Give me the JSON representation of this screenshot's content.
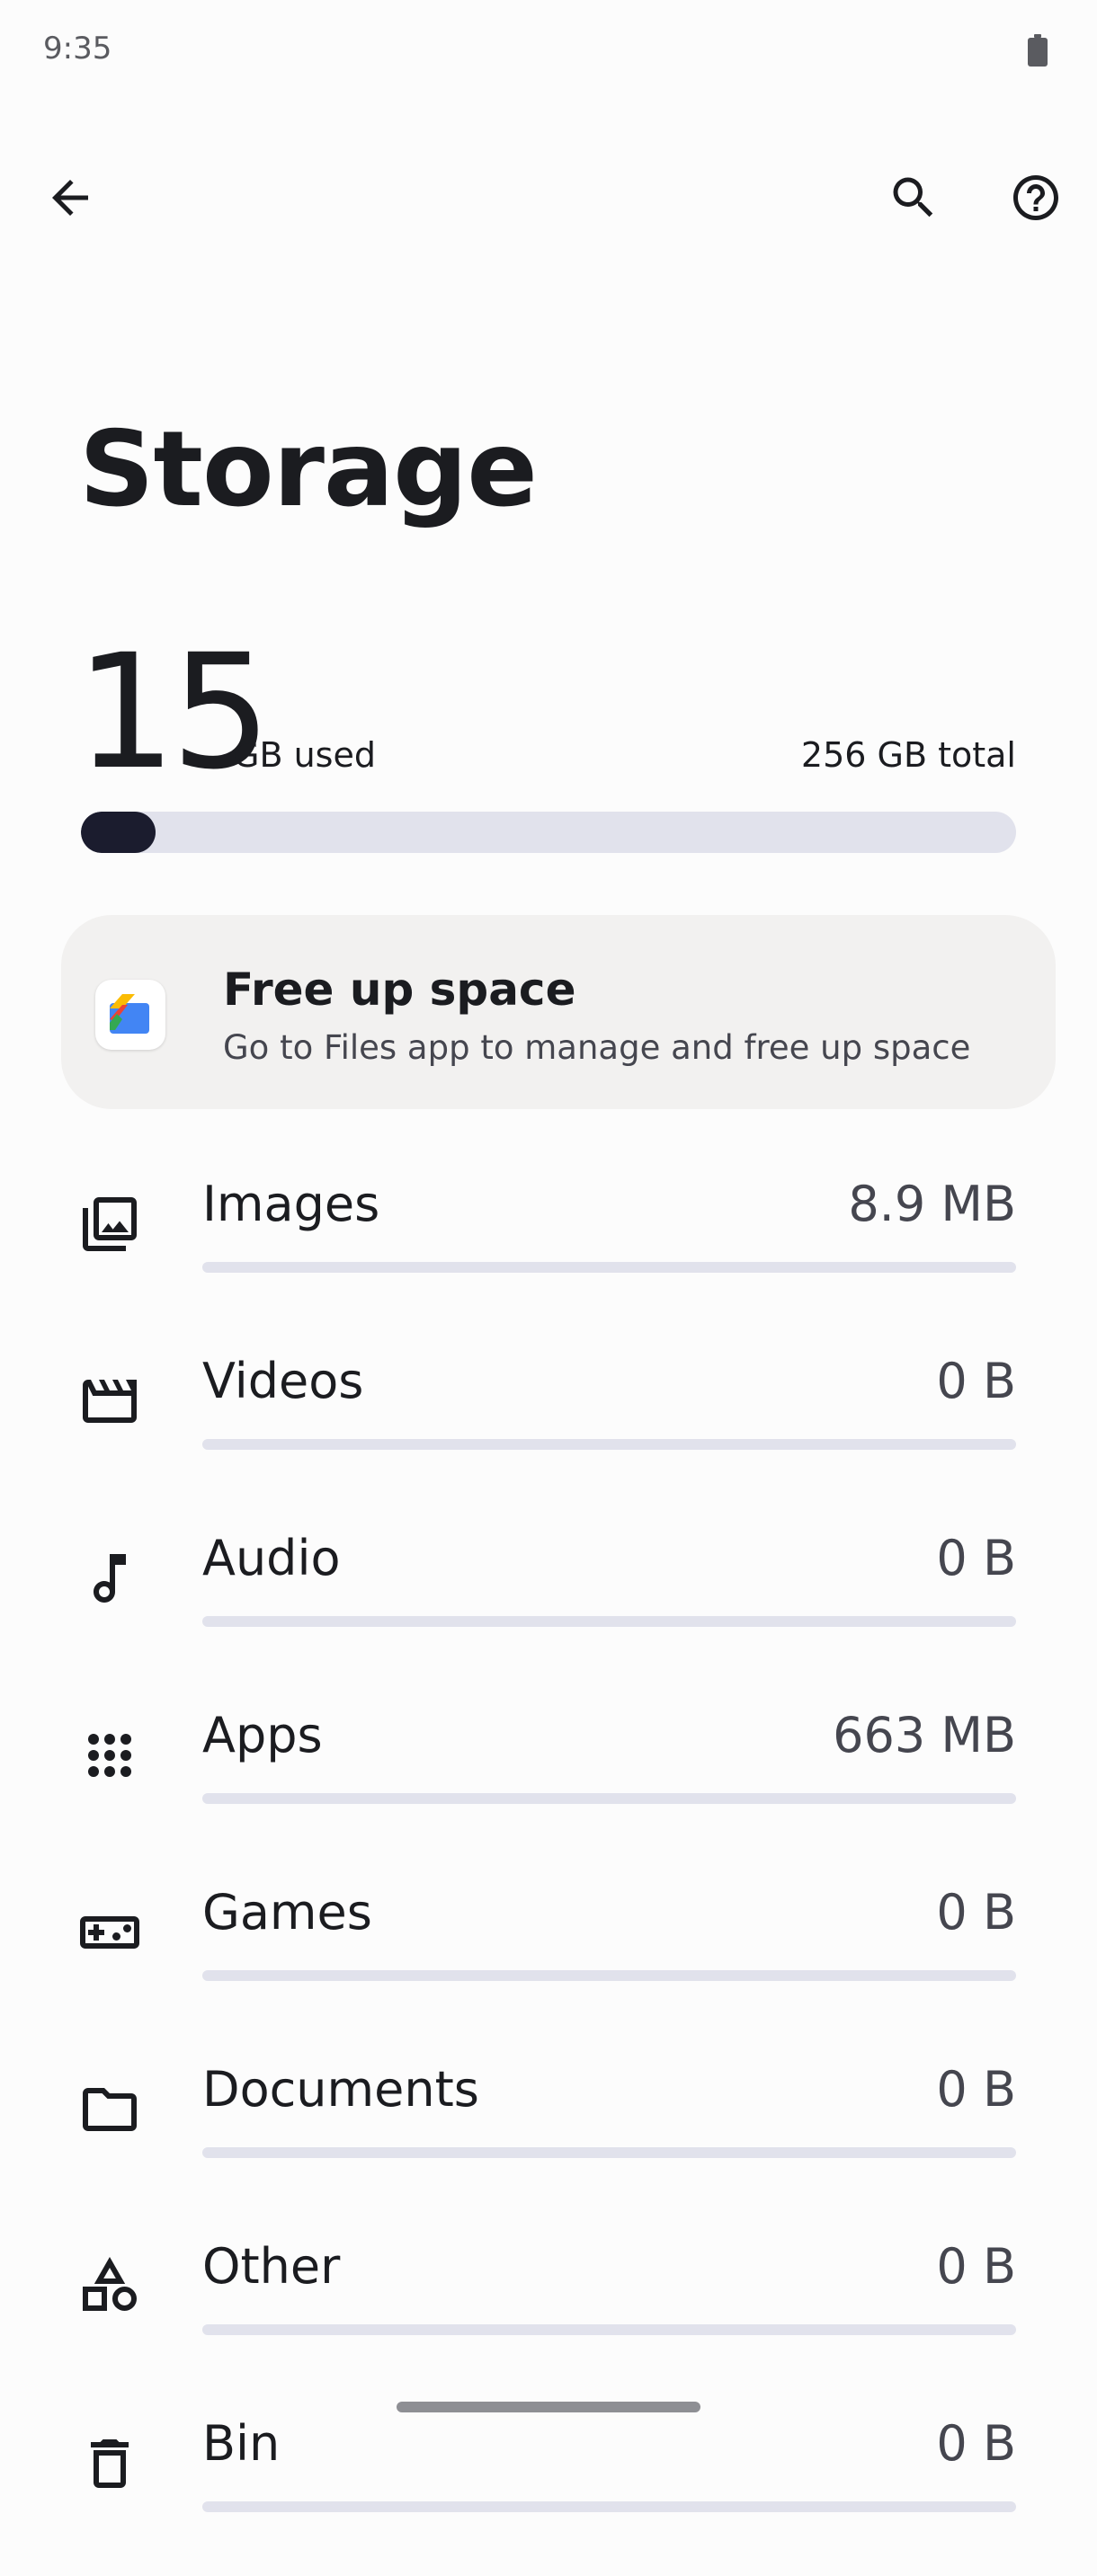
{
  "status_bar": {
    "time": "9:35"
  },
  "toolbar": {
    "back": "back-arrow-icon",
    "search": "search-icon",
    "help": "help-icon"
  },
  "page": {
    "title": "Storage"
  },
  "summary": {
    "used_value": "15",
    "used_unit": "GB used",
    "total": "256 GB total",
    "used_fraction": 0.06
  },
  "free_up": {
    "title": "Free up space",
    "subtitle": "Go to Files app to manage and free up space"
  },
  "categories": [
    {
      "label": "Images",
      "size": "8.9 MB",
      "icon": "image-icon",
      "fraction": 0
    },
    {
      "label": "Videos",
      "size": "0 B",
      "icon": "video-icon",
      "fraction": 0
    },
    {
      "label": "Audio",
      "size": "0 B",
      "icon": "music-note-icon",
      "fraction": 0
    },
    {
      "label": "Apps",
      "size": "663 MB",
      "icon": "apps-grid-icon",
      "fraction": 0
    },
    {
      "label": "Games",
      "size": "0 B",
      "icon": "gamepad-icon",
      "fraction": 0
    },
    {
      "label": "Documents",
      "size": "0 B",
      "icon": "folder-icon",
      "fraction": 0
    },
    {
      "label": "Other",
      "size": "0 B",
      "icon": "shapes-icon",
      "fraction": 0
    },
    {
      "label": "Bin",
      "size": "0 B",
      "icon": "trash-icon",
      "fraction": 0
    }
  ],
  "colors": {
    "accent": "#1b1c2e",
    "track": "#e1e2ec",
    "card": "#f2f1f0"
  }
}
